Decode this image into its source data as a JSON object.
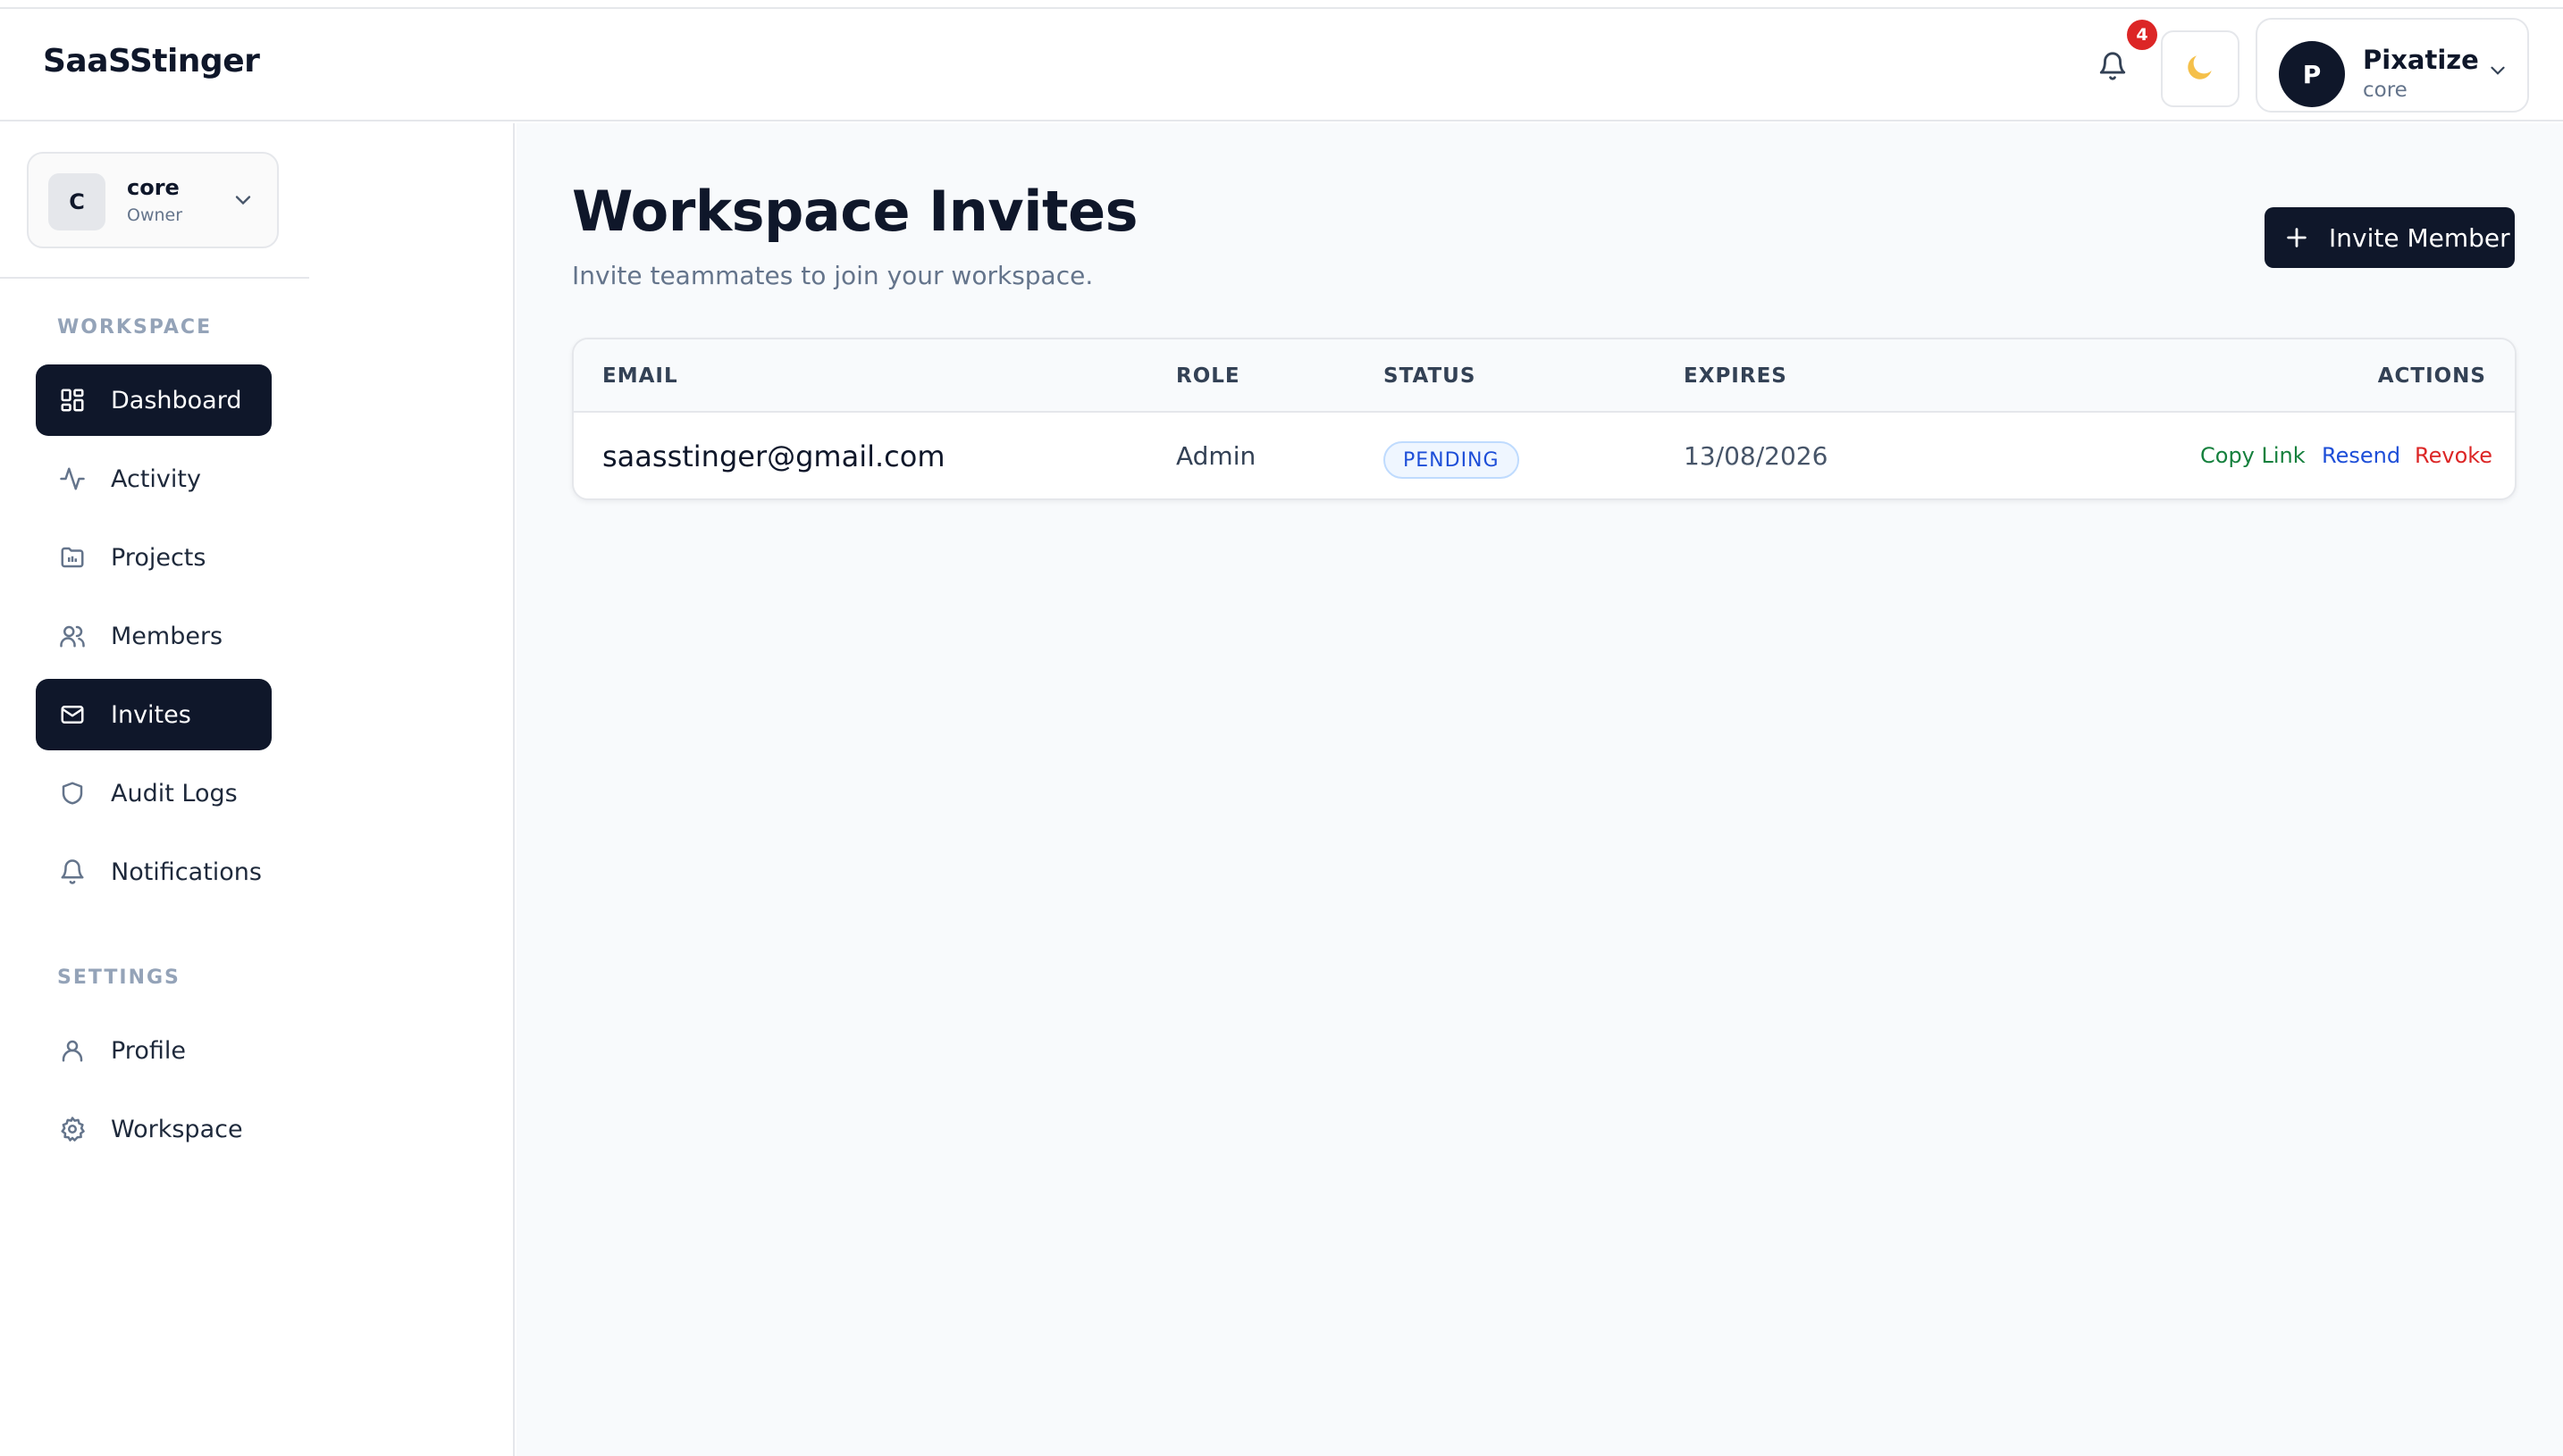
{
  "header": {
    "brand": "SaaSStinger",
    "notification_count": "4",
    "theme_icon": "moon-icon",
    "user": {
      "avatar_initial": "P",
      "name": "Pixatize",
      "workspace": "core"
    }
  },
  "sidebar": {
    "workspace_switcher": {
      "initial": "C",
      "name": "core",
      "role": "Owner"
    },
    "sections": {
      "workspace": "WORKSPACE",
      "settings": "SETTINGS"
    },
    "items": [
      {
        "label": "Dashboard",
        "icon": "grid-icon",
        "active": true
      },
      {
        "label": "Activity",
        "icon": "activity-icon",
        "active": false
      },
      {
        "label": "Projects",
        "icon": "folder-icon",
        "active": false
      },
      {
        "label": "Members",
        "icon": "users-icon",
        "active": false
      },
      {
        "label": "Invites",
        "icon": "mail-icon",
        "active": true
      },
      {
        "label": "Audit Logs",
        "icon": "shield-icon",
        "active": false
      },
      {
        "label": "Notifications",
        "icon": "bell-icon",
        "active": false
      }
    ],
    "settings_items": [
      {
        "label": "Profile",
        "icon": "user-icon"
      },
      {
        "label": "Workspace",
        "icon": "gear-icon"
      }
    ]
  },
  "main": {
    "title": "Workspace Invites",
    "subtitle": "Invite teammates to join your workspace.",
    "invite_button": "Invite Member",
    "table": {
      "headers": {
        "email": "EMAIL",
        "role": "ROLE",
        "status": "STATUS",
        "expires": "EXPIRES",
        "actions": "ACTIONS"
      },
      "rows": [
        {
          "email": "saasstinger@gmail.com",
          "role": "Admin",
          "status": "PENDING",
          "expires": "13/08/2026",
          "actions": {
            "copy": "Copy Link",
            "resend": "Resend",
            "revoke": "Revoke"
          }
        }
      ]
    }
  },
  "colors": {
    "primary": "#0f172a",
    "pending_badge": "#1d4ed8",
    "copy_link": "#15803d",
    "resend": "#1d4ed8",
    "revoke": "#dc2626",
    "notification_badge": "#dc2626"
  }
}
